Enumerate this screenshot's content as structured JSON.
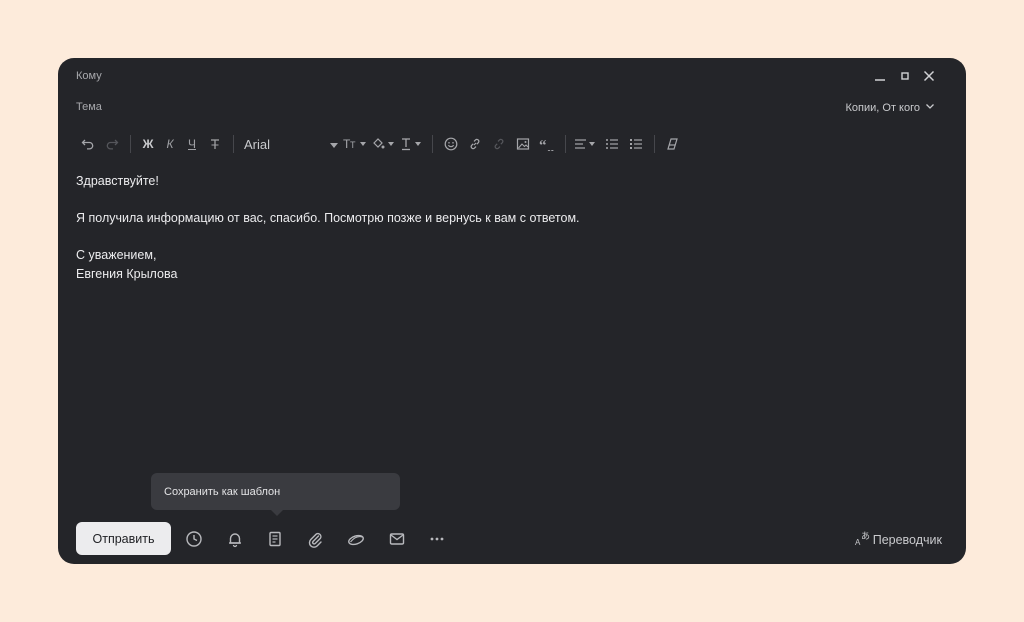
{
  "compose": {
    "to_label": "Кому",
    "subject_label": "Тема",
    "cc_label": "Копии, От кого"
  },
  "toolbar": {
    "bold": "Ж",
    "italic": "К",
    "underline": "Ч",
    "font_name": "Arial"
  },
  "message": {
    "greeting": "Здравствуйте!",
    "body": "Я получила информацию от вас, спасибо. Посмотрю позже и вернусь к вам с ответом.",
    "closing": "С уважением,",
    "signature": "Евгения Крылова"
  },
  "tooltip": {
    "text": "Сохранить как шаблон"
  },
  "footer": {
    "send_label": "Отправить",
    "translator_label": "Переводчик"
  },
  "colors": {
    "page_bg": "#fdebdb",
    "window_bg": "#242529",
    "send_button_bg": "#ececee",
    "tooltip_bg": "#3a3b40"
  }
}
